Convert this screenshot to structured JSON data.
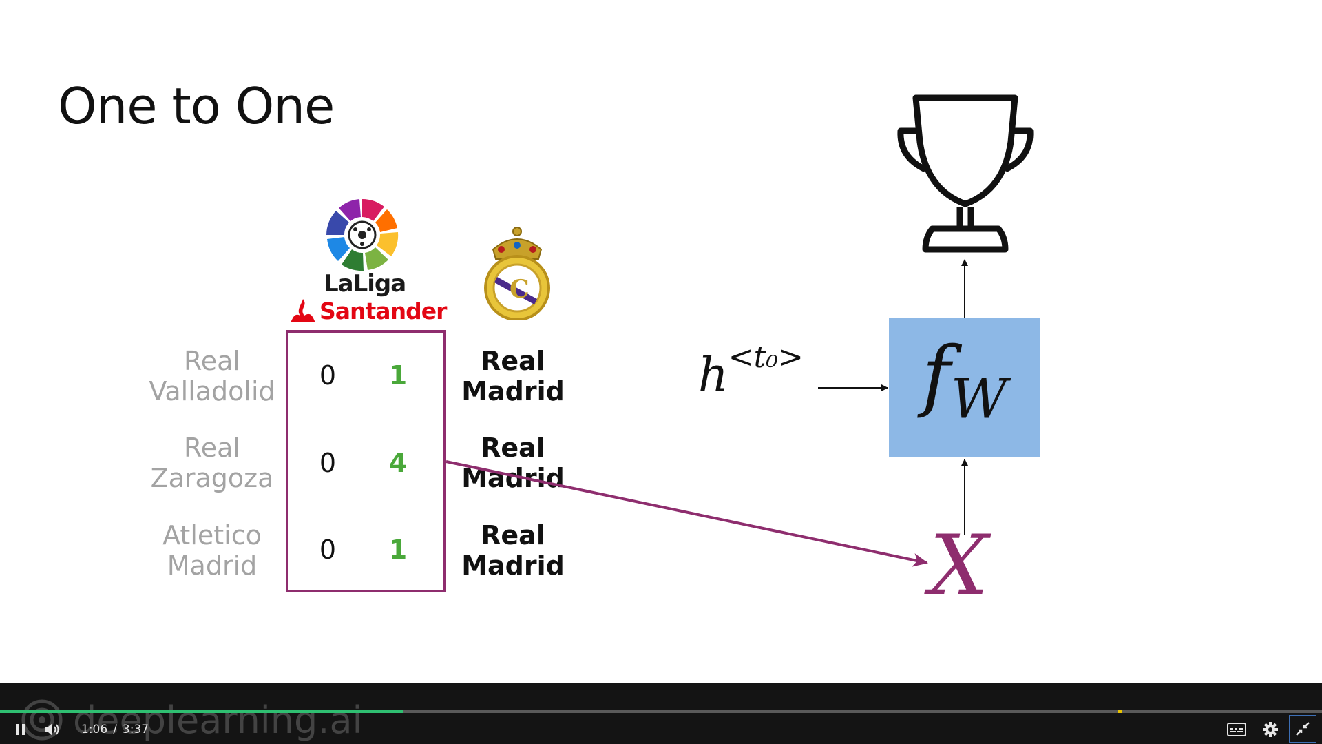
{
  "slide": {
    "title": "One to One",
    "matches": [
      {
        "home_team": "Real Valladolid",
        "home_line1": "Real",
        "home_line2": "Valladolid",
        "home_score": "0",
        "away_score": "1",
        "away_line1": "Real",
        "away_line2": "Madrid"
      },
      {
        "home_team": "Real Zaragoza",
        "home_line1": "Real",
        "home_line2": "Zaragoza",
        "home_score": "0",
        "away_score": "4",
        "away_line1": "Real",
        "away_line2": "Madrid"
      },
      {
        "home_team": "Atletico Madrid",
        "home_line1": "Atletico",
        "home_line2": "Madrid",
        "home_score": "0",
        "away_score": "1",
        "away_line1": "Real",
        "away_line2": "Madrid"
      }
    ],
    "league_logo": {
      "line1": "LaLiga",
      "line2": "Santander"
    },
    "diagram": {
      "hidden_state": "h",
      "hidden_state_sup": "<t₀>",
      "function_name": "f",
      "function_sub": "W",
      "input_var": "X",
      "output_icon": "trophy-icon"
    },
    "colors": {
      "accent": "#8e2d6e",
      "score_win": "#4aa83a",
      "box_fill": "#8db8e6"
    }
  },
  "player": {
    "current_time": "1:06",
    "separator": "/",
    "duration": "3:37",
    "progress_fraction": 0.305,
    "marker_fraction": 0.846,
    "watermark": "deeplearning.ai",
    "icons": [
      "pause-icon",
      "volume-icon",
      "captions-icon",
      "settings-icon",
      "exit-fullscreen-icon"
    ]
  }
}
